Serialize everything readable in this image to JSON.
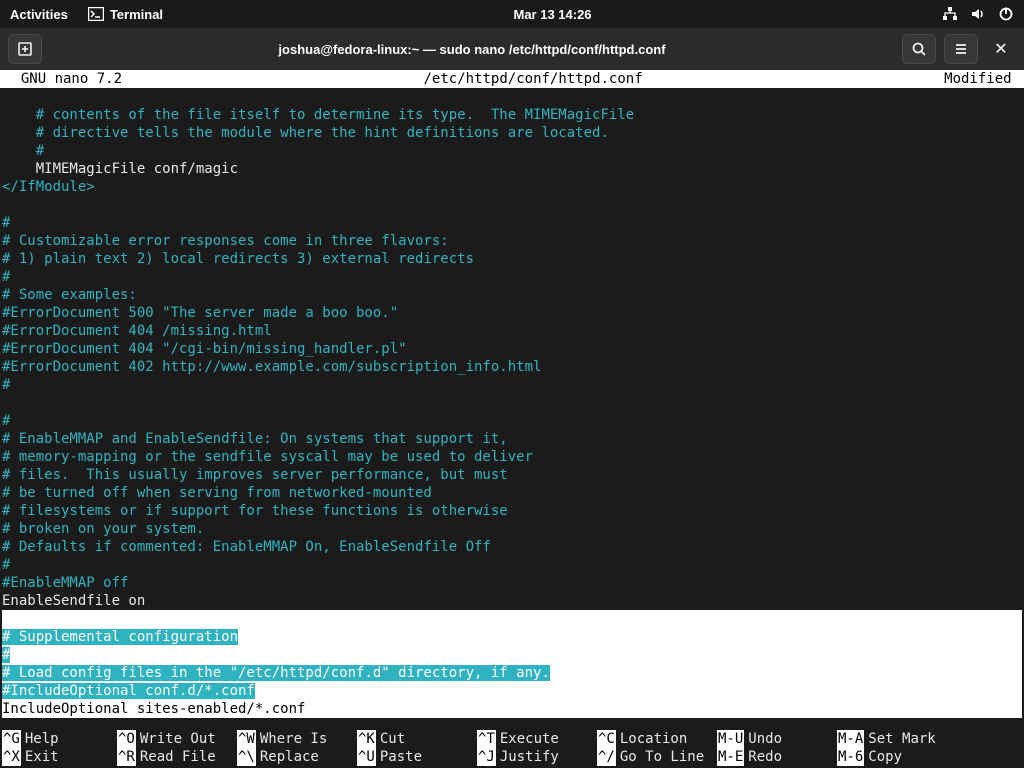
{
  "topbar": {
    "activities": "Activities",
    "terminal": "Terminal",
    "datetime": "Mar 13  14:26"
  },
  "window": {
    "title": "joshua@fedora-linux:~ — sudo nano /etc/httpd/conf/httpd.conf"
  },
  "nano": {
    "version": "  GNU nano 7.2",
    "filepath": "/etc/httpd/conf/httpd.conf",
    "status": "Modified "
  },
  "lines": {
    "l1": "    # contents of the file itself to determine its type.  The MIMEMagicFile",
    "l2": "    # directive tells the module where the hint definitions are located.",
    "l3": "    #",
    "l4": "    MIMEMagicFile conf/magic",
    "l5": "</IfModule>",
    "l6": "#",
    "l7": "# Customizable error responses come in three flavors:",
    "l8": "# 1) plain text 2) local redirects 3) external redirects",
    "l9": "#",
    "l10": "# Some examples:",
    "l11": "#ErrorDocument 500 \"The server made a boo boo.\"",
    "l12": "#ErrorDocument 404 /missing.html",
    "l13": "#ErrorDocument 404 \"/cgi-bin/missing_handler.pl\"",
    "l14": "#ErrorDocument 402 http://www.example.com/subscription_info.html",
    "l15": "#",
    "l16": "#",
    "l17": "# EnableMMAP and EnableSendfile: On systems that support it,",
    "l18": "# memory-mapping or the sendfile syscall may be used to deliver",
    "l19": "# files.  This usually improves server performance, but must",
    "l20": "# be turned off when serving from networked-mounted",
    "l21": "# filesystems or if support for these functions is otherwise",
    "l22": "# broken on your system.",
    "l23": "# Defaults if commented: EnableMMAP On, EnableSendfile Off",
    "l24": "#",
    "l25": "#EnableMMAP off",
    "l26": "EnableSendfile on",
    "l27": "# Supplemental configuration",
    "l28": "#",
    "l29": "# Load config files in the \"/etc/httpd/conf.d\" directory, if any.",
    "l30": "#IncludeOptional conf.d/*.conf",
    "l31": "IncludeOptional sites-enabled/*.conf"
  },
  "shortcuts": {
    "r1": [
      {
        "k": "^G",
        "l": "Help"
      },
      {
        "k": "^O",
        "l": "Write Out"
      },
      {
        "k": "^W",
        "l": "Where Is"
      },
      {
        "k": "^K",
        "l": "Cut"
      },
      {
        "k": "^T",
        "l": "Execute"
      },
      {
        "k": "^C",
        "l": "Location"
      },
      {
        "k": "M-U",
        "l": "Undo"
      },
      {
        "k": "M-A",
        "l": "Set Mark"
      }
    ],
    "r2": [
      {
        "k": "^X",
        "l": "Exit"
      },
      {
        "k": "^R",
        "l": "Read File"
      },
      {
        "k": "^\\",
        "l": "Replace"
      },
      {
        "k": "^U",
        "l": "Paste"
      },
      {
        "k": "^J",
        "l": "Justify"
      },
      {
        "k": "^/",
        "l": "Go To Line"
      },
      {
        "k": "M-E",
        "l": "Redo"
      },
      {
        "k": "M-6",
        "l": "Copy"
      }
    ]
  }
}
